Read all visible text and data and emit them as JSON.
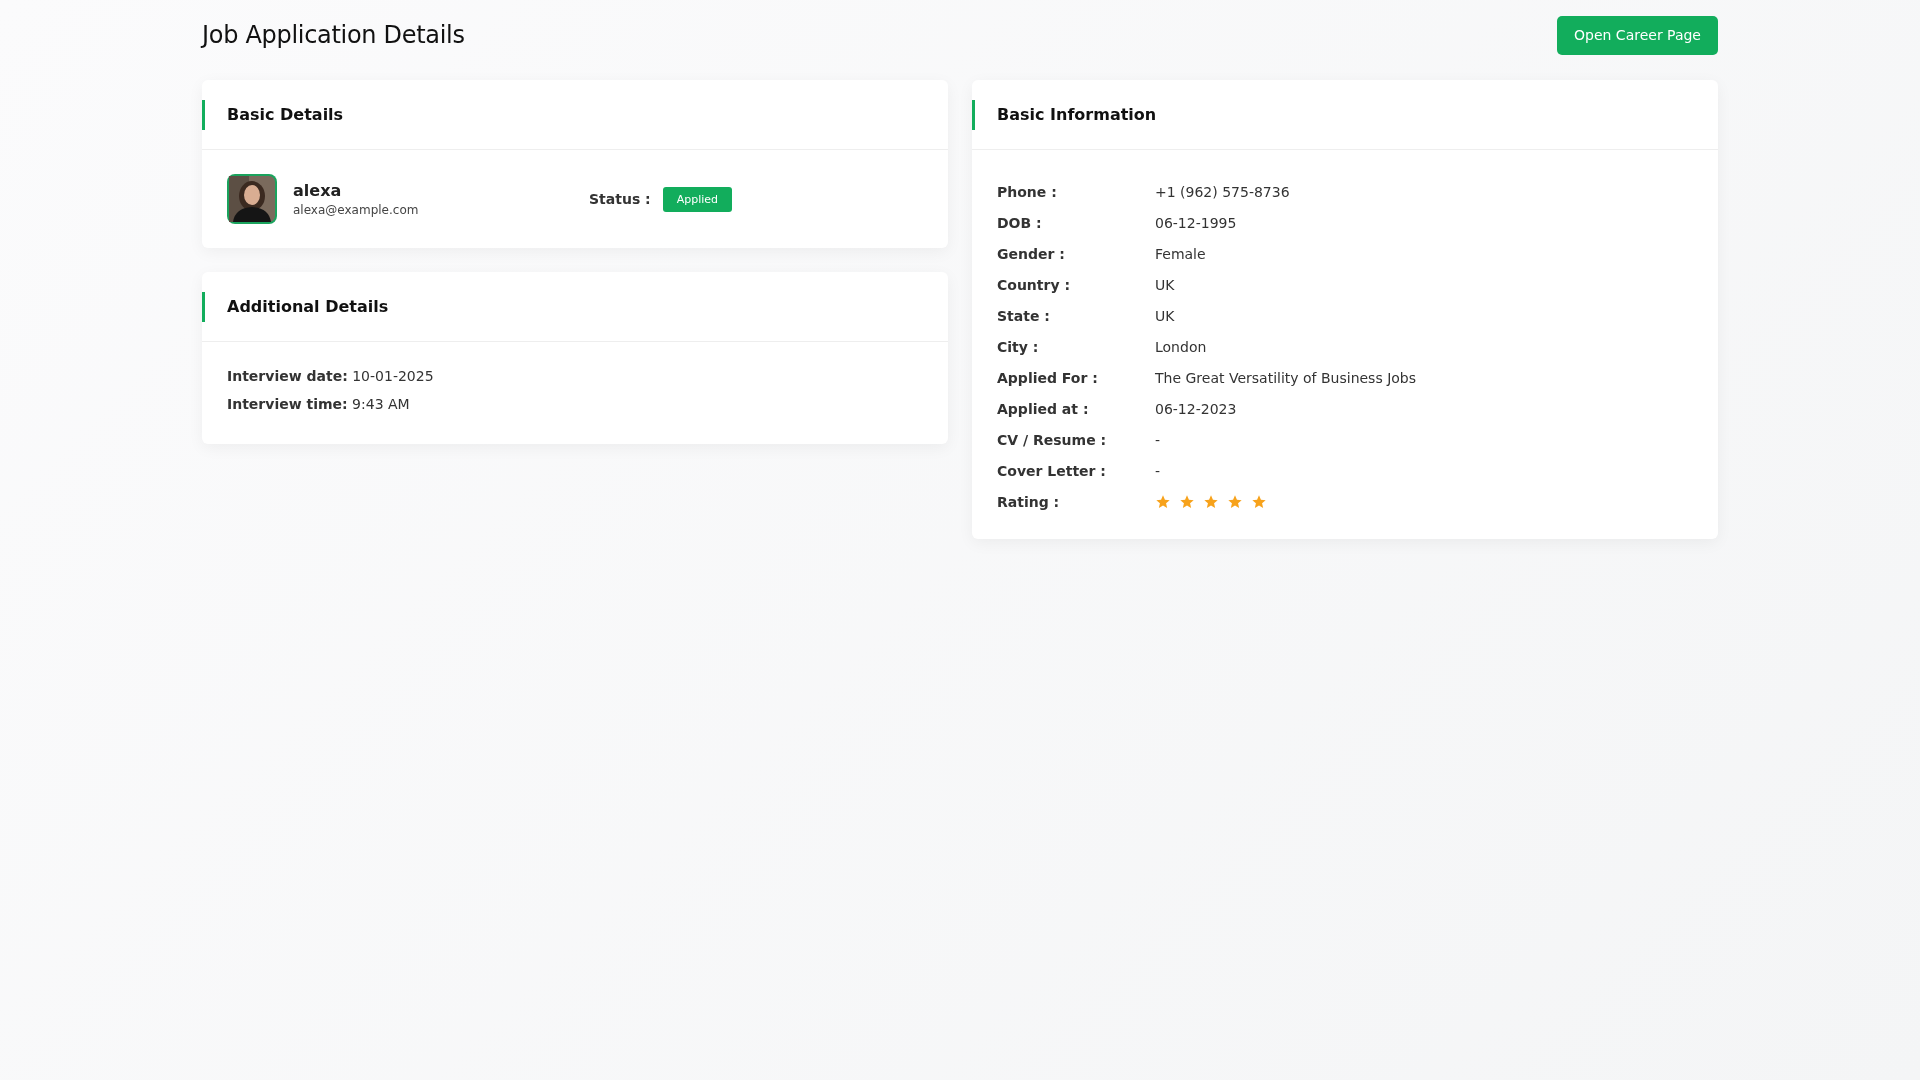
{
  "page": {
    "title": "Job Application Details",
    "action_button": "Open Career Page"
  },
  "basic_details": {
    "title": "Basic Details",
    "name": "alexa",
    "email": "alexa@example.com",
    "status_label": "Status :",
    "status": "Applied"
  },
  "additional_details": {
    "title": "Additional Details",
    "items": [
      {
        "label": "Interview date:",
        "value": "10-01-2025"
      },
      {
        "label": "Interview time:",
        "value": "9:43 AM"
      }
    ]
  },
  "basic_information": {
    "title": "Basic Information",
    "rows": [
      {
        "kind": "text",
        "label": "Phone :",
        "value": "+1 (962) 575-8736"
      },
      {
        "kind": "text",
        "label": "DOB :",
        "value": "06-12-1995"
      },
      {
        "kind": "text",
        "label": "Gender :",
        "value": "Female"
      },
      {
        "kind": "text",
        "label": "Country :",
        "value": "UK"
      },
      {
        "kind": "text",
        "label": "State :",
        "value": "UK"
      },
      {
        "kind": "text",
        "label": "City :",
        "value": "London"
      },
      {
        "kind": "text",
        "label": "Applied For :",
        "value": "The Great Versatility of Business Jobs"
      },
      {
        "kind": "text",
        "label": "Applied at :",
        "value": "06-12-2023"
      },
      {
        "kind": "text",
        "label": "CV / Resume :",
        "value": "-"
      },
      {
        "kind": "text",
        "label": "Cover Letter :",
        "value": "-"
      },
      {
        "kind": "rating",
        "label": "Rating :",
        "stars": 5
      }
    ]
  }
}
